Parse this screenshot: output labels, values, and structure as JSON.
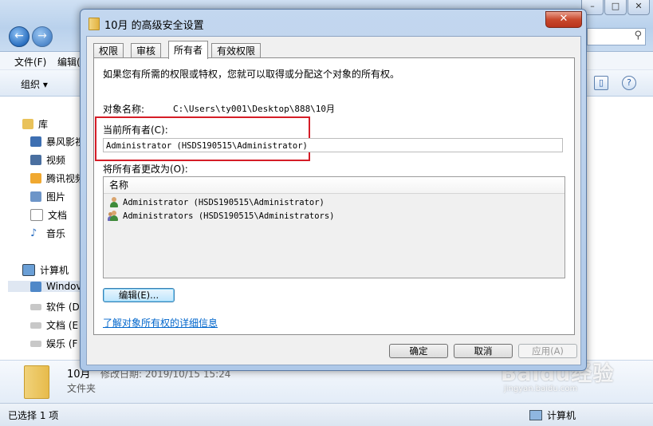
{
  "explorer": {
    "menu": {
      "file": "文件(F)",
      "edit": "编辑("
    },
    "toolbar": {
      "organize": "组织 ▾"
    },
    "tree": {
      "library": "库",
      "items": [
        "暴风影视",
        "视频",
        "腾讯视频",
        "图片",
        "文档",
        "音乐"
      ],
      "computer": "计算机",
      "drives": [
        "Windov",
        "软件 (D",
        "文档 (E",
        "娱乐 (F"
      ]
    },
    "details": {
      "name": "10月",
      "modified": "修改日期: 2019/10/15 15:24",
      "type": "文件夹"
    },
    "status": {
      "selected": "已选择 1 项",
      "computer": "计算机"
    }
  },
  "watermark": {
    "main": "Baidu经验",
    "sub": "jingyan.baidu.com"
  },
  "dialog": {
    "title": "10月 的高级安全设置",
    "close_label": "✕",
    "tabs": [
      "权限",
      "审核",
      "所有者",
      "有效权限"
    ],
    "active_tab": 2,
    "intro": "如果您有所需的权限或特权，您就可以取得或分配这个对象的所有权。",
    "object_name_label": "对象名称:",
    "object_name_value": "C:\\Users\\ty001\\Desktop\\888\\10月",
    "current_owner_label": "当前所有者(C):",
    "current_owner_value": "Administrator (HSDS190515\\Administrator)",
    "change_owner_label": "将所有者更改为(O):",
    "list": {
      "header": "名称",
      "rows": [
        {
          "icon": "user-icon",
          "text": "Administrator (HSDS190515\\Administrator)"
        },
        {
          "icon": "user-group-icon",
          "text": "Administrators (HSDS190515\\Administrators)"
        }
      ]
    },
    "edit_button": "编辑(E)...",
    "learn_link": "了解对象所有权的详细信息",
    "buttons": {
      "ok": "确定",
      "cancel": "取消",
      "apply": "应用(A)"
    },
    "highlight_color": "#d51d27"
  }
}
